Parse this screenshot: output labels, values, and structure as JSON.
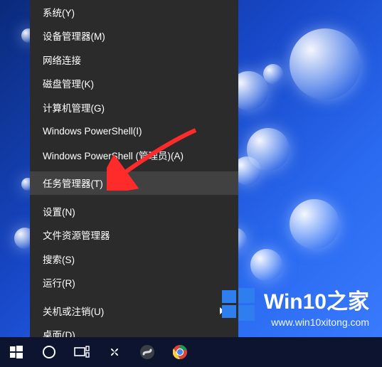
{
  "menu": {
    "items": [
      {
        "label": "系统(Y)"
      },
      {
        "label": "设备管理器(M)"
      },
      {
        "label": "网络连接"
      },
      {
        "label": "磁盘管理(K)"
      },
      {
        "label": "计算机管理(G)"
      },
      {
        "label": "Windows PowerShell(I)"
      },
      {
        "label": "Windows PowerShell (管理员)(A)"
      }
    ],
    "task_manager": "任务管理器(T)",
    "settings": "设置(N)",
    "explorer": "文件资源管理器",
    "search": "搜索(S)",
    "run": "运行(R)",
    "shutdown": "关机或注销(U)",
    "desktop": "桌面(D)"
  },
  "watermark": {
    "title": "Win10之家",
    "url": "www.win10xitong.com"
  },
  "colors": {
    "menu_bg": "#2b2b2b",
    "menu_hover": "#414141",
    "taskbar_bg": "#0c1430",
    "accent": "#2f7ef0",
    "arrow": "#ff2a2a"
  }
}
